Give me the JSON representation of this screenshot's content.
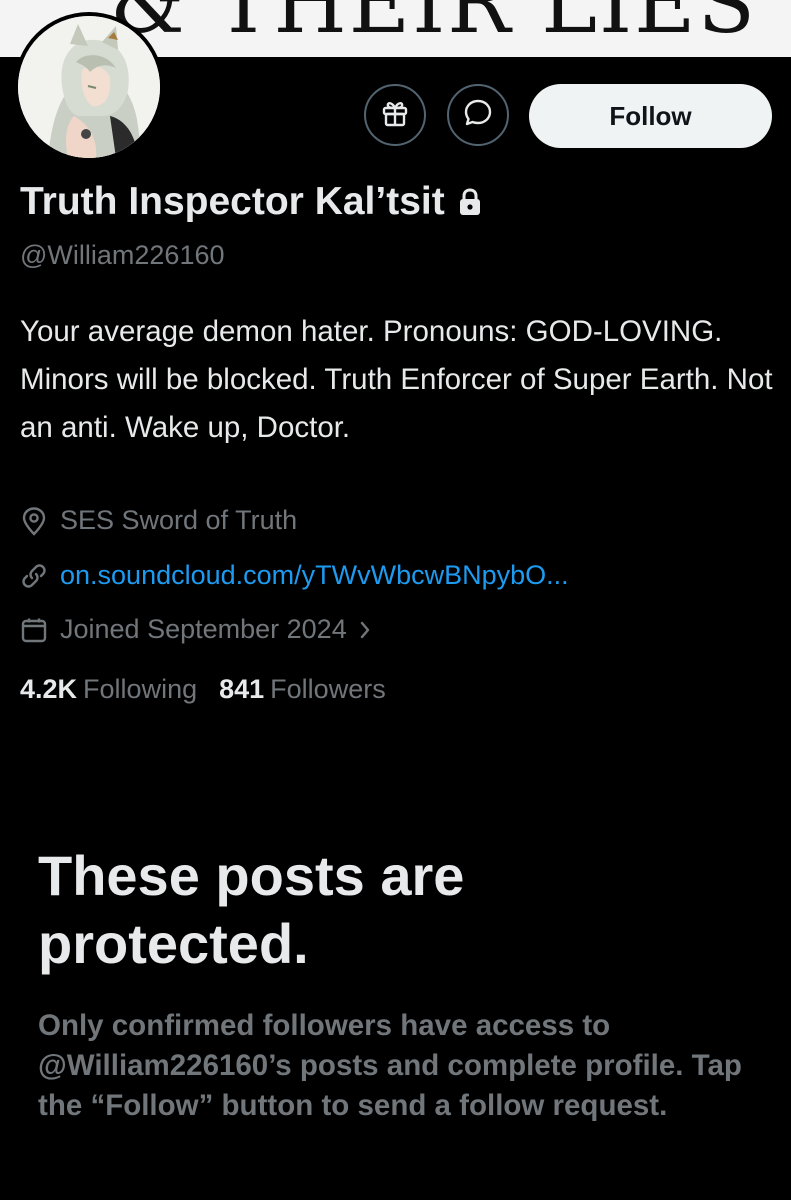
{
  "banner": {
    "text": "& THEIR LIES"
  },
  "profile": {
    "display_name": "Truth Inspector Kal’tsit",
    "handle": "@William226160",
    "bio": "Your average demon hater. Pronouns: GOD-LOVING. Minors will be blocked. Truth Enforcer of Super Earth. Not an anti. Wake up, Doctor.",
    "location": "SES Sword of Truth",
    "website": "on.soundcloud.com/yTWvWbcwBNpybO...",
    "joined": "Joined September 2024",
    "following_count": "4.2K",
    "following_label": "Following",
    "followers_count": "841",
    "followers_label": "Followers"
  },
  "actions": {
    "gift_icon": "gift-icon",
    "message_icon": "message-icon",
    "follow_label": "Follow"
  },
  "protected": {
    "title": "These posts are protected.",
    "description": "Only confirmed followers have access to @William226160’s posts and complete profile. Tap the “Follow” button to send a follow request."
  },
  "colors": {
    "background": "#000000",
    "primary_text": "#e7e9ea",
    "secondary_text": "#71767b",
    "link": "#1d9bf0",
    "follow_button": "#eff3f4"
  }
}
